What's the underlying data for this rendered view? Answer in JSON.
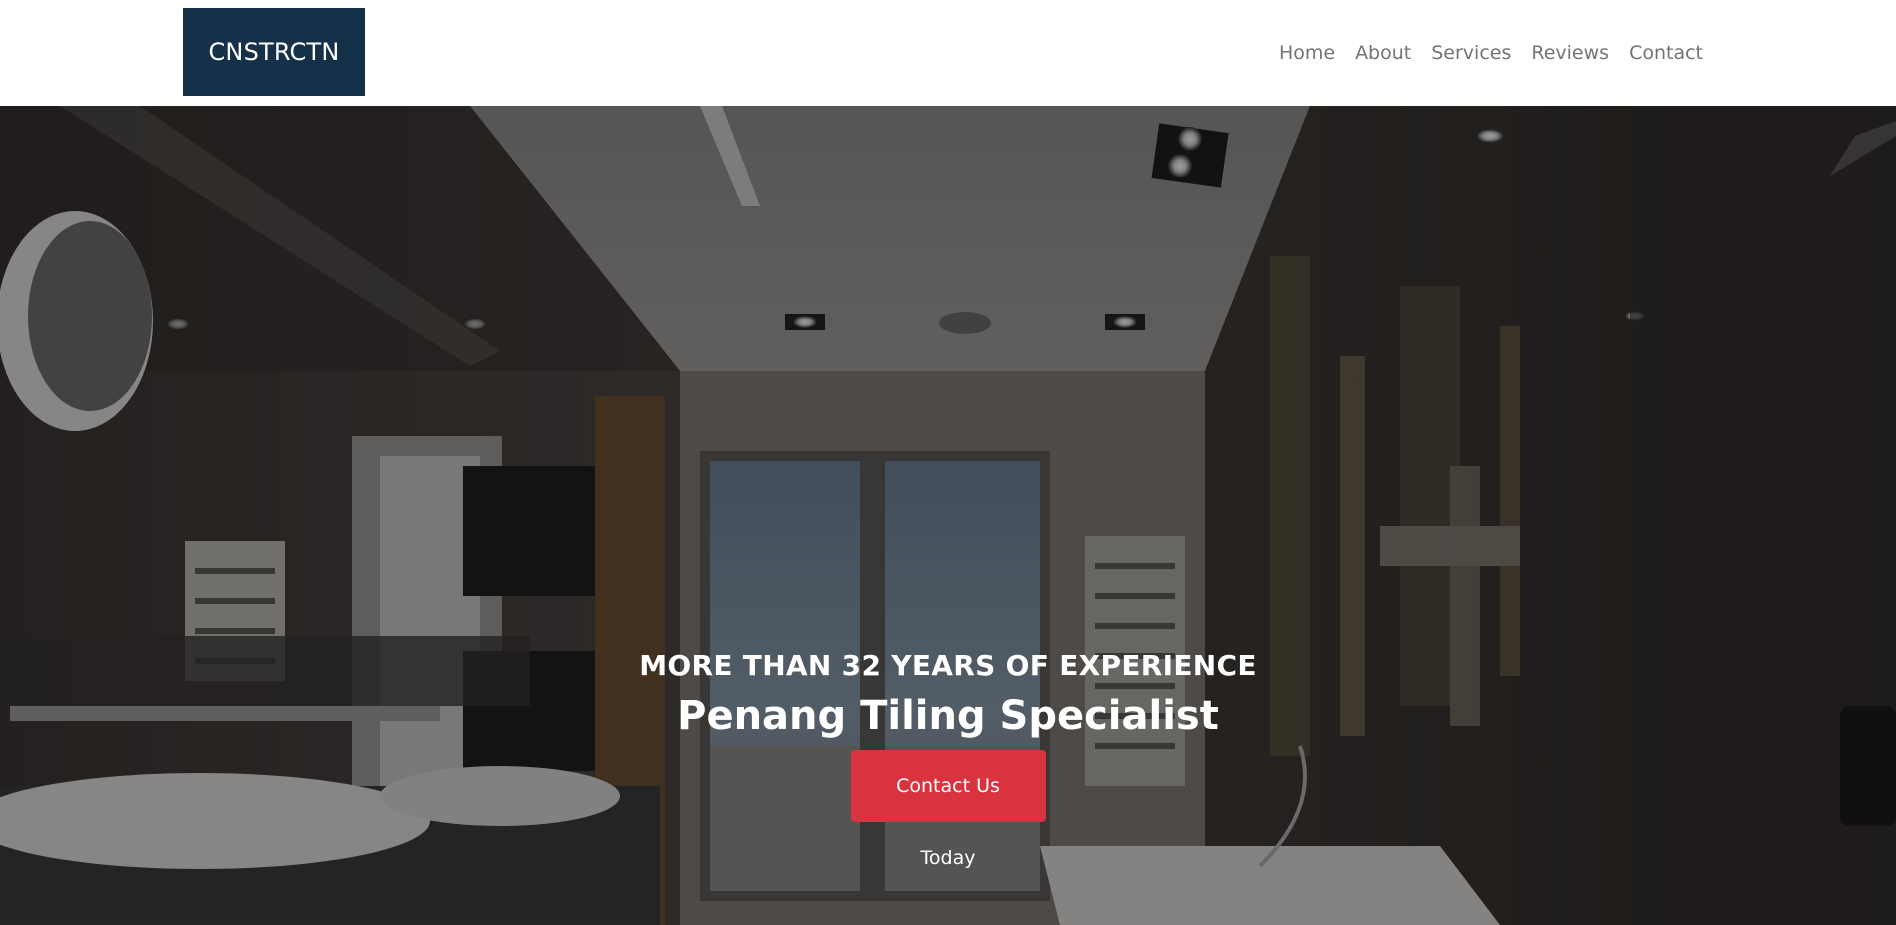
{
  "brand": {
    "name": "CNSTRCTN",
    "color": "#15314a"
  },
  "nav": {
    "items": [
      {
        "label": "Home"
      },
      {
        "label": "About"
      },
      {
        "label": "Services"
      },
      {
        "label": "Reviews"
      },
      {
        "label": "Contact"
      }
    ],
    "text_color": "#747474"
  },
  "hero": {
    "tagline": "MORE THAN 32 YEARS OF EXPERIENCE",
    "title": "Penang Tiling Specialist",
    "cta_label": "Contact Us Today",
    "cta_color": "#d9333f",
    "background": "bathroom-photo"
  }
}
